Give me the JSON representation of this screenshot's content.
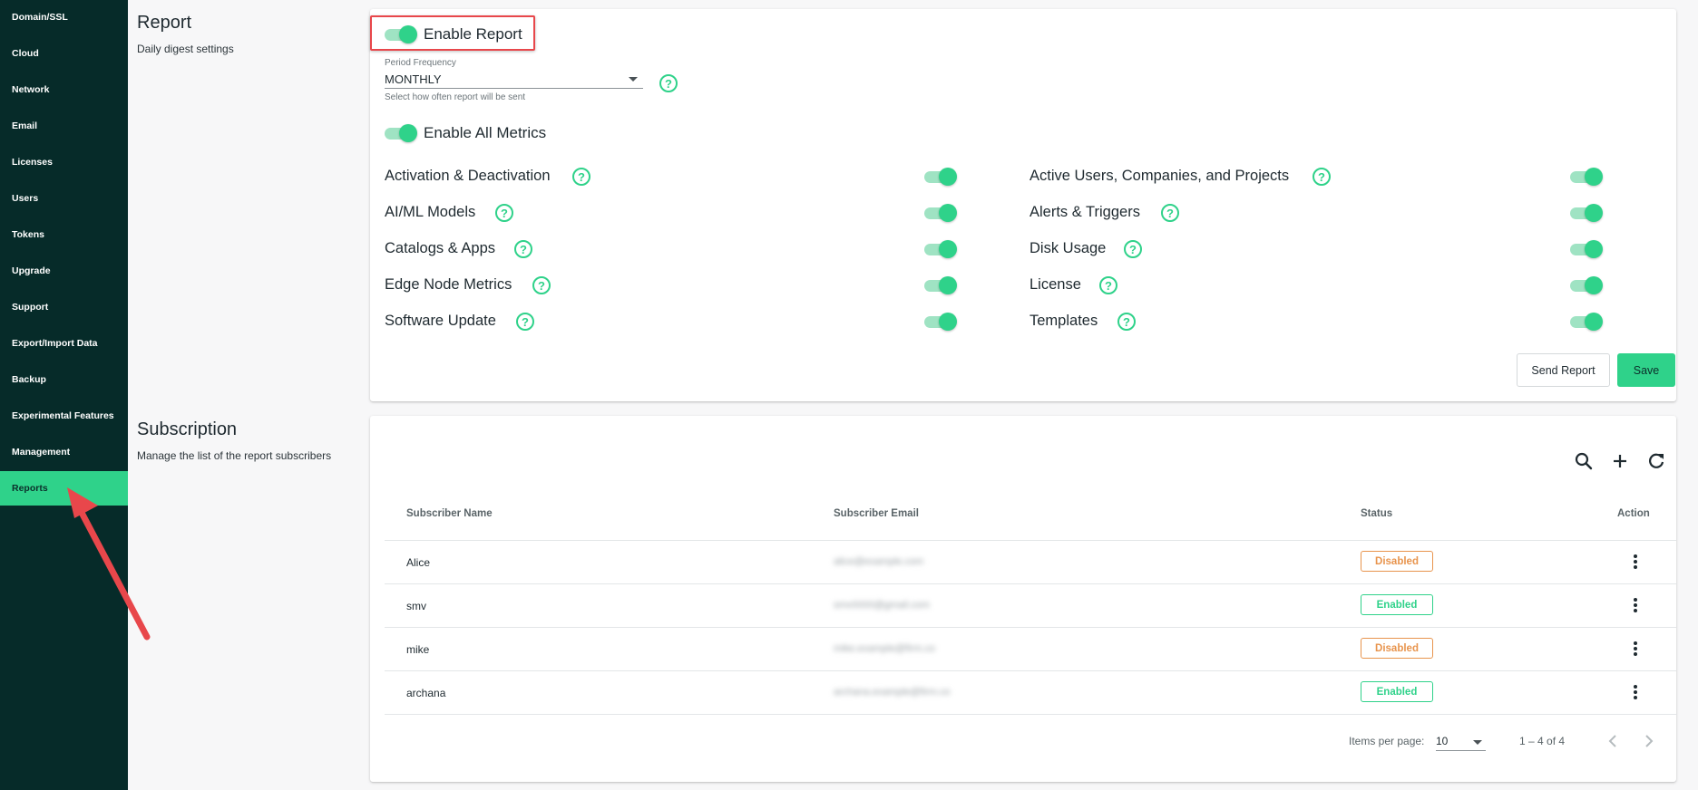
{
  "sidebar": {
    "items": [
      {
        "label": "Domain/SSL"
      },
      {
        "label": "Cloud"
      },
      {
        "label": "Network"
      },
      {
        "label": "Email"
      },
      {
        "label": "Licenses"
      },
      {
        "label": "Users"
      },
      {
        "label": "Tokens"
      },
      {
        "label": "Upgrade"
      },
      {
        "label": "Support"
      },
      {
        "label": "Export/Import Data"
      },
      {
        "label": "Backup"
      },
      {
        "label": "Experimental Features"
      },
      {
        "label": "Management"
      },
      {
        "label": "Reports",
        "active": true
      }
    ]
  },
  "report_section": {
    "title": "Report",
    "subtitle": "Daily digest settings"
  },
  "report_card": {
    "enable_report_label": "Enable Report",
    "enable_report_on": true,
    "period_field_label": "Period Frequency",
    "period_value": "MONTHLY",
    "period_hint": "Select how often report will be sent",
    "enable_all_label": "Enable All Metrics",
    "enable_all_on": true,
    "metrics_left": [
      {
        "label": "Activation & Deactivation",
        "on": true
      },
      {
        "label": "AI/ML Models",
        "on": true
      },
      {
        "label": "Catalogs & Apps",
        "on": true
      },
      {
        "label": "Edge Node Metrics",
        "on": true
      },
      {
        "label": "Software Update",
        "on": true
      }
    ],
    "metrics_right": [
      {
        "label": "Active Users, Companies, and Projects",
        "on": true
      },
      {
        "label": "Alerts & Triggers",
        "on": true
      },
      {
        "label": "Disk Usage",
        "on": true
      },
      {
        "label": "License",
        "on": true
      },
      {
        "label": "Templates",
        "on": true
      }
    ],
    "send_report_label": "Send Report",
    "save_label": "Save"
  },
  "subscription_section": {
    "title": "Subscription",
    "subtitle": "Manage the list of the report subscribers"
  },
  "subscription_table": {
    "headers": {
      "name": "Subscriber Name",
      "email": "Subscriber Email",
      "status": "Status",
      "action": "Action"
    },
    "rows": [
      {
        "name": "Alice",
        "email": "alice@example.com",
        "status": "Disabled"
      },
      {
        "name": "smv",
        "email": "smv0000@gmail.com",
        "status": "Enabled"
      },
      {
        "name": "mike",
        "email": "mike.example@firm.co",
        "status": "Disabled"
      },
      {
        "name": "archana",
        "email": "archana.example@firm.co",
        "status": "Enabled"
      }
    ],
    "items_per_page_label": "Items per page:",
    "items_per_page_value": "10",
    "range_label": "1 – 4 of 4"
  },
  "icons": {
    "toolbar": [
      "search-icon",
      "add-icon",
      "refresh-icon"
    ],
    "row_action": "more-vert-icon",
    "pager": [
      "chevron-left-icon",
      "chevron-right-icon"
    ]
  },
  "colors": {
    "sidebar_bg": "#062b29",
    "accent": "#2fd28a",
    "disabled_badge": "#e8944d",
    "highlight": "#e8474b"
  }
}
